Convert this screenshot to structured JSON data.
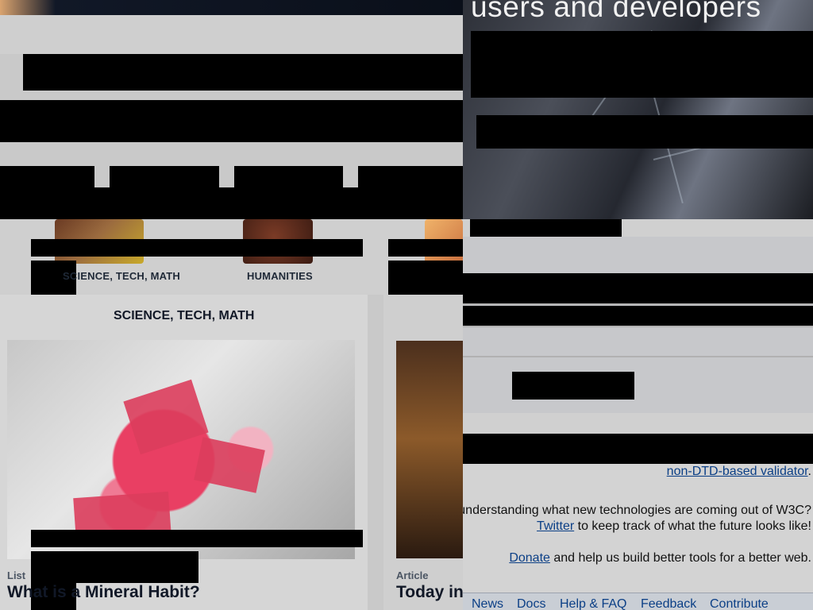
{
  "left": {
    "categories": {
      "first": "SCIENCE, TECH, MATH",
      "second": "HUMANITIES"
    },
    "section_heading": "SCIENCE, TECH, MATH",
    "cards": [
      {
        "kind": "List",
        "title": "What is a Mineral Habit?"
      },
      {
        "kind": "Article",
        "title": "Today in"
      }
    ]
  },
  "right": {
    "banner_title": "users and developers",
    "lines": [
      {
        "prefix": "",
        "link": "non-DTD-based validator",
        "suffix": "."
      },
      {
        "prefix": "understanding what new technologies are coming out of W3C?",
        "link": "",
        "suffix": ""
      },
      {
        "prefix": "",
        "link": "Twitter",
        "suffix": " to keep track of what the future looks like!"
      },
      {
        "prefix": "",
        "link": "Donate",
        "suffix": " and help us build better tools for a better web."
      }
    ],
    "footer_links": [
      "News",
      "Docs",
      "Help & FAQ",
      "Feedback",
      "Contribute"
    ]
  }
}
